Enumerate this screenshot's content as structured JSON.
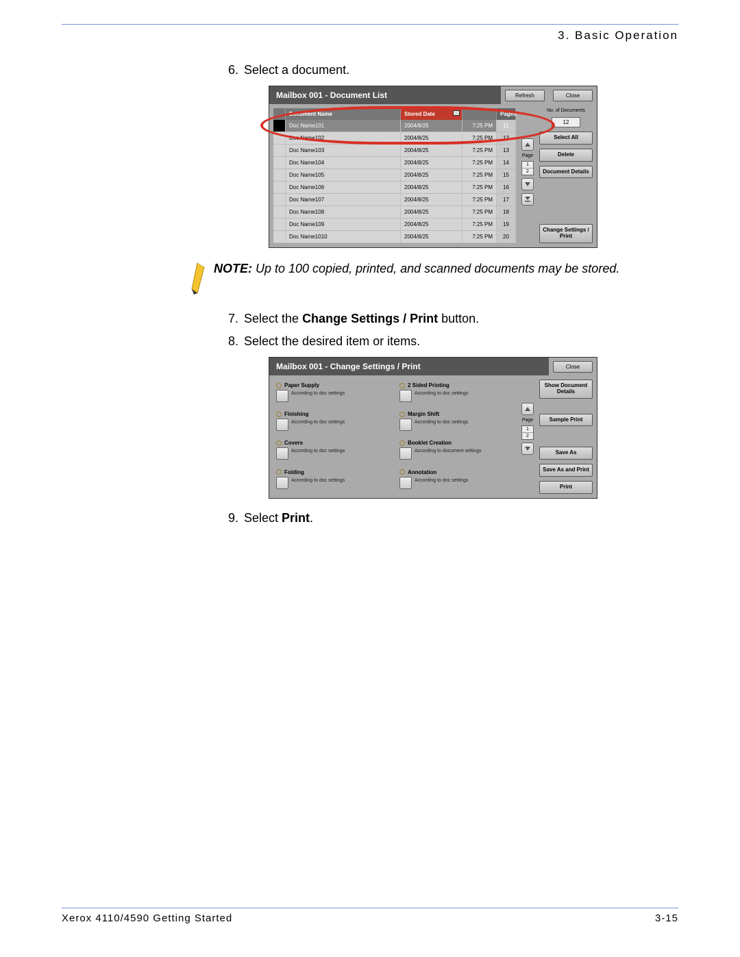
{
  "header": {
    "section": "3. Basic Operation"
  },
  "steps": {
    "s6": "Select a document.",
    "s7_pre": "Select the ",
    "s7_bold": "Change Settings / Print",
    "s7_post": " button.",
    "s8": "Select the desired item or items.",
    "s9_pre": "Select ",
    "s9_bold": "Print",
    "s9_post": "."
  },
  "note": {
    "label": "NOTE:",
    "text": " Up to 100 copied, printed, and scanned documents may be stored."
  },
  "ui1": {
    "title": "Mailbox 001 - Document List",
    "refresh": "Refresh",
    "close": "Close",
    "cols": {
      "name": "Document Name",
      "date": "Stored Date",
      "pages": "Pages"
    },
    "rows": [
      {
        "name": "Doc Name101",
        "date": "2004/8/25",
        "time": "7:25 PM",
        "pg": "11"
      },
      {
        "name": "Doc Name102",
        "date": "2004/8/25",
        "time": "7:25 PM",
        "pg": "12"
      },
      {
        "name": "Doc Name103",
        "date": "2004/8/25",
        "time": "7:25 PM",
        "pg": "13"
      },
      {
        "name": "Doc Name104",
        "date": "2004/8/25",
        "time": "7:25 PM",
        "pg": "14"
      },
      {
        "name": "Doc Name105",
        "date": "2004/8/25",
        "time": "7:25 PM",
        "pg": "15"
      },
      {
        "name": "Doc Name106",
        "date": "2004/8/25",
        "time": "7:25 PM",
        "pg": "16"
      },
      {
        "name": "Doc Name107",
        "date": "2004/8/25",
        "time": "7:25 PM",
        "pg": "17"
      },
      {
        "name": "Doc Name108",
        "date": "2004/8/25",
        "time": "7:25 PM",
        "pg": "18"
      },
      {
        "name": "Doc Name109",
        "date": "2004/8/25",
        "time": "7:25 PM",
        "pg": "19"
      },
      {
        "name": "Doc Name1010",
        "date": "2004/8/25",
        "time": "7:25 PM",
        "pg": "20"
      }
    ],
    "scroll": {
      "page_lbl": "Page",
      "p1": "1",
      "p2": "2"
    },
    "right": {
      "count_lbl": "No. of Documents",
      "count": "12",
      "select_all": "Select All",
      "delete": "Delete",
      "details": "Document Details",
      "change": "Change Settings / Print"
    }
  },
  "ui2": {
    "title": "Mailbox 001 - Change Settings / Print",
    "close": "Close",
    "settings": {
      "paper": {
        "label": "Paper Supply",
        "val": "According to doc settings"
      },
      "twosided": {
        "label": "2 Sided Printing",
        "val": "According to doc settings"
      },
      "finishing": {
        "label": "Finishing",
        "val": "According to doc settings"
      },
      "margin": {
        "label": "Margin Shift",
        "val": "According to doc settings"
      },
      "covers": {
        "label": "Covers",
        "val": "According to doc settings"
      },
      "booklet": {
        "label": "Booklet Creation",
        "val": "According to document settings"
      },
      "folding": {
        "label": "Folding",
        "val": "According to doc settings"
      },
      "annotation": {
        "label": "Annotation",
        "val": "According to doc settings"
      }
    },
    "scroll": {
      "page_lbl": "Page",
      "p1": "1",
      "p2": "2"
    },
    "right": {
      "show": "Show Document Details",
      "sample": "Sample Print",
      "saveas": "Save As",
      "saveprint": "Save As and Print",
      "print": "Print"
    }
  },
  "footer": {
    "left": "Xerox 4110/4590 Getting Started",
    "right": "3-15"
  }
}
